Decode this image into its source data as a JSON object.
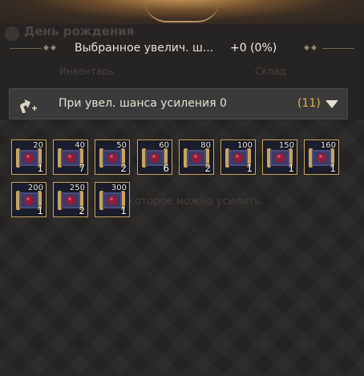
{
  "header": {
    "ghost_title": "День рождения",
    "summary_label": "Выбранное увелич. ш...",
    "summary_value": "+0 (0%)",
    "ghost_tab_left": "Инвентарь",
    "ghost_tab_right": "Склад"
  },
  "filter": {
    "icon": "enhance-arrow-icon",
    "label": "При увел. шанса усиления 0",
    "count": "(11)",
    "dropdown_icon": "chevron-down-icon"
  },
  "background_hint": "которое можно усилить",
  "colors": {
    "slot_border": "#c9a55b",
    "count_text": "#e1b341",
    "scroll_parchment": "#4b4c7a",
    "gem": "#8e1e3a"
  },
  "items": [
    {
      "level": "20",
      "qty": "1"
    },
    {
      "level": "40",
      "qty": "7"
    },
    {
      "level": "50",
      "qty": "2"
    },
    {
      "level": "60",
      "qty": "6"
    },
    {
      "level": "80",
      "qty": "2"
    },
    {
      "level": "100",
      "qty": "1"
    },
    {
      "level": "150",
      "qty": "1"
    },
    {
      "level": "160",
      "qty": "1"
    },
    {
      "level": "200",
      "qty": "1"
    },
    {
      "level": "250",
      "qty": "2"
    },
    {
      "level": "300",
      "qty": "1"
    }
  ]
}
